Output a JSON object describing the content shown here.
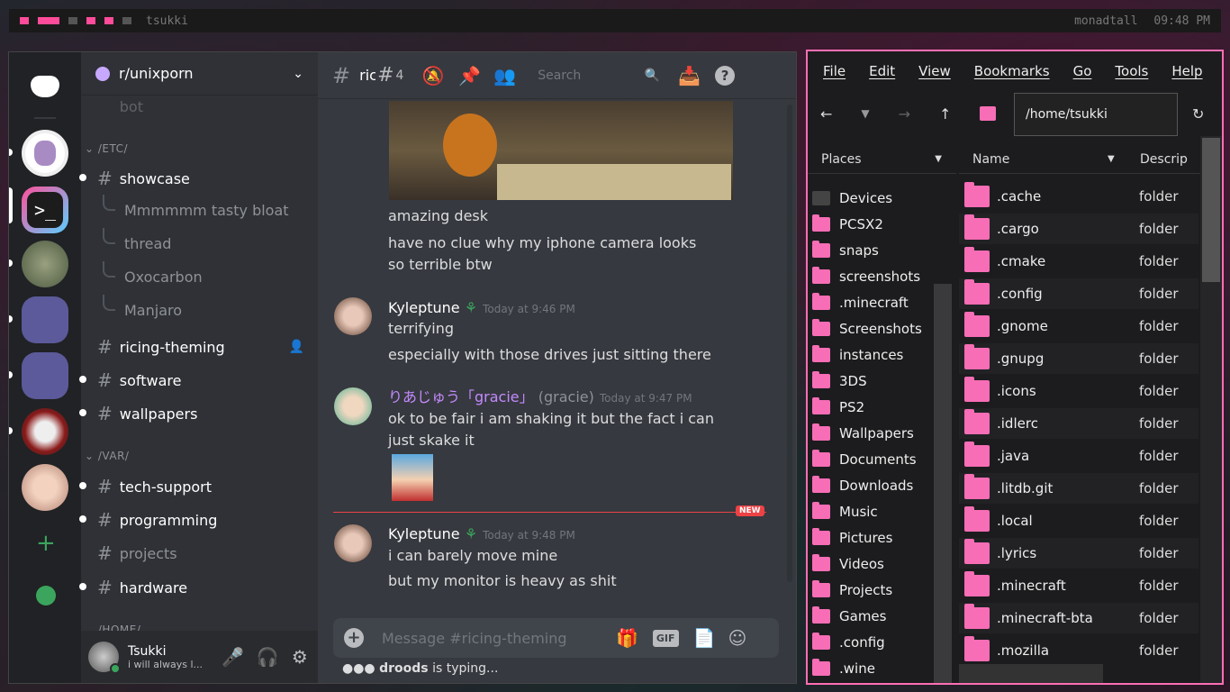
{
  "topbar": {
    "title": "tsukki",
    "layout": "monadtall",
    "time": "09:48 PM"
  },
  "discord": {
    "server_name": "r/unixporn",
    "categories": {
      "etc": "/ETC/",
      "var": "/VAR/",
      "home": "/HOME/"
    },
    "faded_channel": "bot",
    "channels": {
      "showcase": "showcase",
      "ricing": "ricing-theming",
      "software": "software",
      "wallpapers": "wallpapers",
      "tech": "tech-support",
      "programming": "programming",
      "projects": "projects",
      "hardware": "hardware"
    },
    "threads": [
      "Mmmmmm tasty bloat",
      "thread",
      "Oxocarbon",
      "Manjaro"
    ],
    "user": {
      "name": "Tsukki",
      "status": "i will always l..."
    },
    "header": {
      "channel": "ric",
      "thread_count": "4",
      "search": "Search"
    },
    "messages": {
      "m1a": "amazing desk",
      "m1b": "have no clue why my iphone camera looks so terrible btw",
      "m2_author": "Kyleptune",
      "m2_ts": "Today at 9:46 PM",
      "m2a": "terrifying",
      "m2b": "especially with those drives just sitting there",
      "m3_author": "りあじゅう「gracie」",
      "m3_user": "(gracie)",
      "m3_ts": "Today at 9:47 PM",
      "m3a": "ok to be fair i am shaking it but the fact i can just skake it",
      "new": "NEW",
      "m4_author": "Kyleptune",
      "m4_ts": "Today at 9:48 PM",
      "m4a": "i can barely move mine",
      "m4b": "but my monitor is heavy as shit"
    },
    "composer_placeholder": "Message #ricing-theming",
    "gif": "GIF",
    "typing_user": "droods",
    "typing_text": "is typing..."
  },
  "filemanager": {
    "menu": [
      "File",
      "Edit",
      "View",
      "Bookmarks",
      "Go",
      "Tools",
      "Help"
    ],
    "path": "/home/tsukki",
    "places_header": "Places",
    "places": [
      "Devices",
      "PCSX2",
      "snaps",
      "screenshots",
      ".minecraft",
      "Screenshots",
      "instances",
      "3DS",
      "PS2",
      "Wallpapers",
      "Documents",
      "Downloads",
      "Music",
      "Pictures",
      "Videos",
      "Projects",
      "Games",
      ".config",
      ".wine"
    ],
    "cols": {
      "name": "Name",
      "desc": "Descrip"
    },
    "files": [
      ".cache",
      ".cargo",
      ".cmake",
      ".config",
      ".gnome",
      ".gnupg",
      ".icons",
      ".idlerc",
      ".java",
      ".litdb.git",
      ".local",
      ".lyrics",
      ".minecraft",
      ".minecraft-bta",
      ".mozilla"
    ],
    "type": "folder"
  },
  "colors": {
    "accent": "#ff6eb4",
    "folder": "#f76db6",
    "discord_bg": "#36393f"
  }
}
